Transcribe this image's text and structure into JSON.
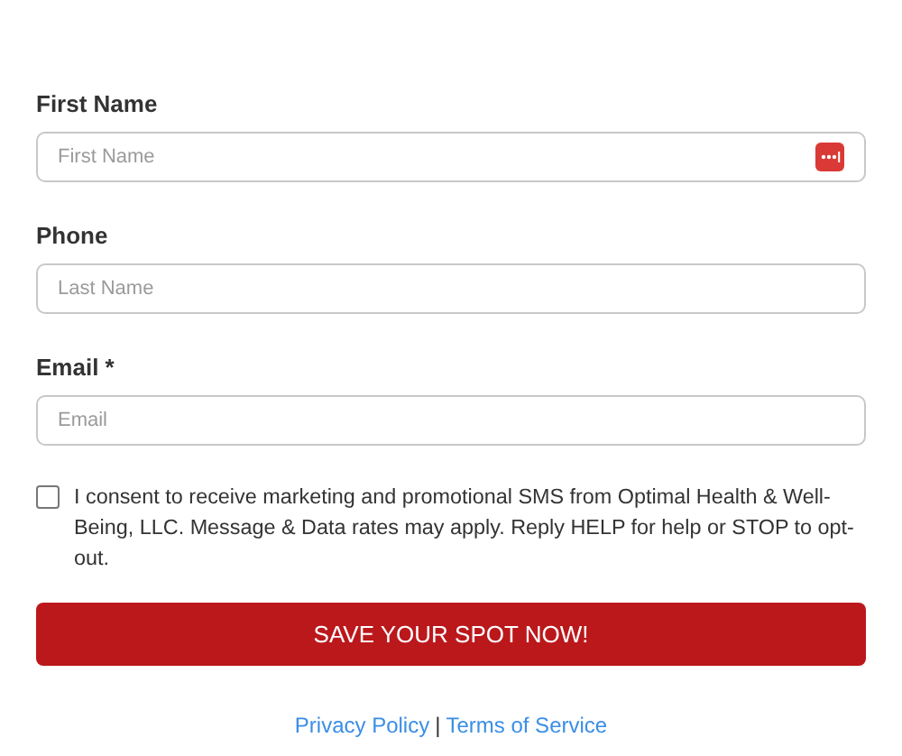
{
  "fields": [
    {
      "label": "First Name",
      "placeholder": "First Name",
      "autofill_icon": true
    },
    {
      "label": "Phone",
      "placeholder": "Last Name",
      "autofill_icon": false
    },
    {
      "label": "Email *",
      "placeholder": "Email",
      "autofill_icon": false
    }
  ],
  "consent": {
    "checked": false,
    "text": "I consent to receive marketing and promotional SMS from Optimal Health & Well-Being, LLC. Message & Data rates may apply. Reply HELP for help or STOP to opt-out."
  },
  "submit": "SAVE YOUR SPOT NOW!",
  "links": [
    {
      "label": "Privacy Policy"
    },
    {
      "label": "Terms of Service"
    }
  ],
  "link_separator": "|"
}
